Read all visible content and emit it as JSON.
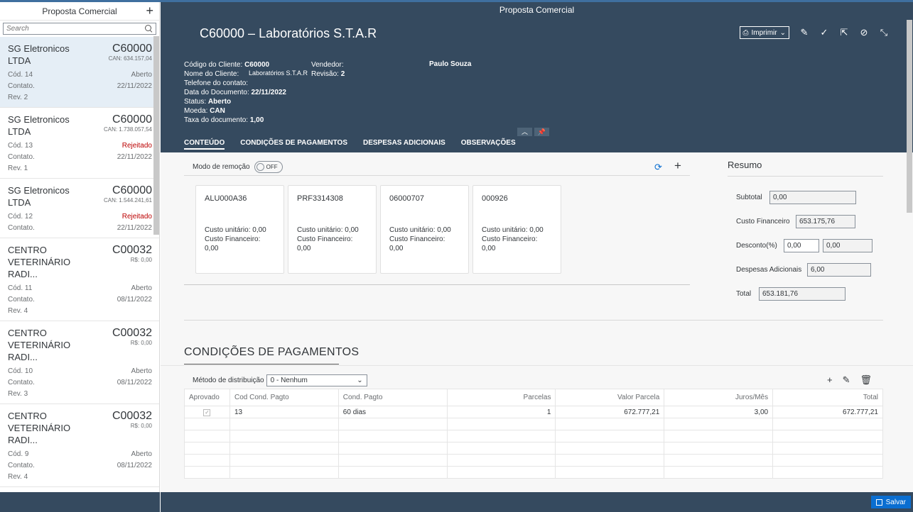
{
  "app": {
    "title": "Proposta Comercial"
  },
  "master": {
    "title": "Proposta Comercial",
    "search_placeholder": "Search",
    "items": [
      {
        "title": "SG Eletronicos LTDA",
        "code": "C60000",
        "amount": "CAN: 634.157,04",
        "cod": "Cód. 14",
        "status": "Aberto",
        "status_type": "normal",
        "contato": "Contato.",
        "date": "22/11/2022",
        "rev": "Rev. 2"
      },
      {
        "title": "SG Eletronicos LTDA",
        "code": "C60000",
        "amount": "CAN: 1.738.057,54",
        "cod": "Cód. 13",
        "status": "Rejeitado",
        "status_type": "negative",
        "contato": "Contato.",
        "date": "22/11/2022",
        "rev": "Rev. 1"
      },
      {
        "title": "SG Eletronicos LTDA",
        "code": "C60000",
        "amount": "CAN: 1.544.241,61",
        "cod": "Cód. 12",
        "status": "Rejeitado",
        "status_type": "negative",
        "contato": "Contato.",
        "date": "22/11/2022",
        "rev": ""
      },
      {
        "title": "CENTRO VETERINÁRIO RADI...",
        "code": "C00032",
        "amount": "R$: 0,00",
        "cod": "Cód. 11",
        "status": "Aberto",
        "status_type": "normal",
        "contato": "Contato.",
        "date": "08/11/2022",
        "rev": "Rev. 4"
      },
      {
        "title": "CENTRO VETERINÁRIO RADI...",
        "code": "C00032",
        "amount": "R$: 0,00",
        "cod": "Cód. 10",
        "status": "Aberto",
        "status_type": "normal",
        "contato": "Contato.",
        "date": "08/11/2022",
        "rev": "Rev. 3"
      },
      {
        "title": "CENTRO VETERINÁRIO RADI...",
        "code": "C00032",
        "amount": "R$: 0,00",
        "cod": "Cód. 9",
        "status": "Aberto",
        "status_type": "normal",
        "contato": "Contato.",
        "date": "08/11/2022",
        "rev": "Rev. 4"
      }
    ]
  },
  "header": {
    "title": "C60000 – Laboratórios S.T.A.R",
    "print_label": "Imprimir",
    "attrs": {
      "codigo_label": "Código do Cliente:",
      "codigo_value": "C60000",
      "nome_label": "Nome do Cliente:",
      "nome_value": "Laboratórios S.T.A.R",
      "telefone_label": "Telefone do contato:",
      "data_label": "Data do Documento:",
      "data_value": "22/11/2022",
      "status_label": "Status:",
      "status_value": "Aberto",
      "moeda_label": "Moeda:",
      "moeda_value": "CAN",
      "taxa_label": "Taxa do documento:",
      "taxa_value": "1,00"
    },
    "vendedor_label": "Vendedor:",
    "vendedor_value": "Paulo Souza",
    "revisao_label": "Revisão:",
    "revisao_value": "2"
  },
  "tabs": [
    "CONTEÚDO",
    "CONDIÇÕES DE PAGAMENTOS",
    "DESPESAS ADICIONAIS",
    "OBSERVAÇÕES"
  ],
  "conteudo": {
    "modo_label": "Modo de remoção",
    "toggle_label": "OFF",
    "cards": [
      {
        "code": "ALU000A36",
        "custo_unit": "Custo unitário: 0,00",
        "custo_fin": "Custo Financeiro: 0,00"
      },
      {
        "code": "PRF3314308",
        "custo_unit": "Custo unitário: 0,00",
        "custo_fin": "Custo Financeiro: 0,00"
      },
      {
        "code": "06000707",
        "custo_unit": "Custo unitário: 0,00",
        "custo_fin": "Custo Financeiro: 0,00"
      },
      {
        "code": "000926",
        "custo_unit": "Custo unitário: 0,00",
        "custo_fin": "Custo Financeiro: 0,00"
      }
    ]
  },
  "resumo": {
    "title": "Resumo",
    "subtotal_label": "Subtotal",
    "subtotal": "0,00",
    "custo_fin_label": "Custo Financeiro",
    "custo_fin": "653.175,76",
    "desconto_label": "Desconto(%)",
    "desconto_pct": "0,00",
    "desconto_val": "0,00",
    "despesas_label": "Despesas Adicionais",
    "despesas": "6,00",
    "total_label": "Total",
    "total": "653.181,76"
  },
  "condicoes": {
    "title": "CONDIÇÕES DE PAGAMENTOS",
    "metodo_label": "Método de distribuição",
    "metodo_value": "0 - Nenhum",
    "columns": [
      "Aprovado",
      "Cod Cond. Pagto",
      "Cond. Pagto",
      "Parcelas",
      "Valor Parcela",
      "Juros/Mês",
      "Total"
    ],
    "row": {
      "cod": "13",
      "cond": "60 dias",
      "parcelas": "1",
      "valor": "672.777,21",
      "juros": "3,00",
      "total": "672.777,21"
    }
  },
  "footer": {
    "save_label": "Salvar"
  }
}
